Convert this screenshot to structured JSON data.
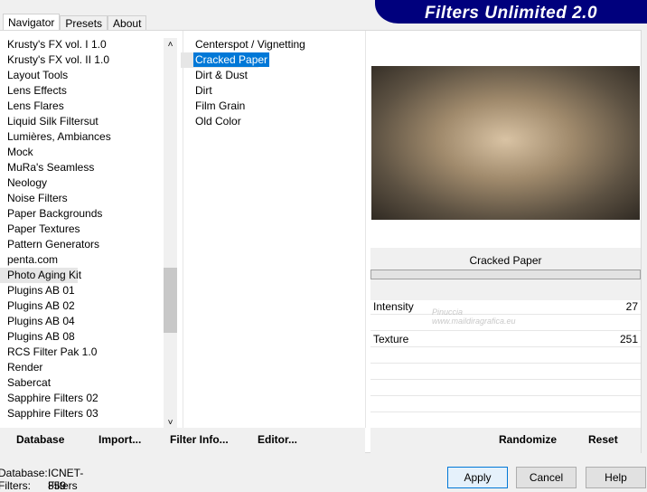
{
  "banner": {
    "title": "Filters Unlimited 2.0"
  },
  "tabs": [
    {
      "label": "Navigator"
    },
    {
      "label": "Presets"
    },
    {
      "label": "About"
    }
  ],
  "categories": {
    "items": [
      "Krusty's FX vol. I 1.0",
      "Krusty's FX vol. II 1.0",
      "Layout Tools",
      "Lens Effects",
      "Lens Flares",
      "Liquid Silk Filtersut",
      "Lumières, Ambiances",
      "Mock",
      "MuRa's Seamless",
      "Neology",
      "Noise Filters",
      "Paper Backgrounds",
      "Paper Textures",
      "Pattern Generators",
      "penta.com",
      "Photo Aging Kit",
      "Plugins AB 01",
      "Plugins AB 02",
      "Plugins AB 04",
      "Plugins AB 08",
      "RCS Filter Pak 1.0",
      "Render",
      "Sabercat",
      "Sapphire Filters 02",
      "Sapphire Filters 03"
    ],
    "selected": "Photo Aging Kit"
  },
  "filters": {
    "items": [
      "Centerspot / Vignetting",
      "Cracked Paper",
      "Dirt & Dust",
      "Dirt",
      "Film Grain",
      "Old Color"
    ],
    "selected": "Cracked Paper"
  },
  "preview": {
    "filter_name": "Cracked Paper",
    "params": [
      {
        "label": "Intensity",
        "value": "27"
      },
      {
        "label": "Texture",
        "value": "251"
      }
    ]
  },
  "watermark": {
    "line1": "Pinuccia",
    "line2": "www.maildiragrafica.eu"
  },
  "buttons": {
    "database": "Database",
    "import": "Import...",
    "filter_info": "Filter Info...",
    "editor": "Editor...",
    "randomize": "Randomize",
    "reset": "Reset",
    "apply": "Apply",
    "cancel": "Cancel",
    "help": "Help"
  },
  "status": {
    "database_label": "Database:",
    "database_value": "ICNET-Filters",
    "filters_label": "Filters:",
    "filters_value": "859"
  }
}
